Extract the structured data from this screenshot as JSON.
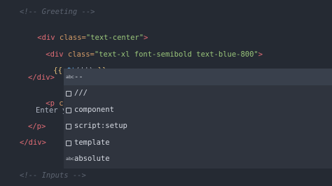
{
  "editor": {
    "lines": {
      "comment_greeting": "<!-- Greeting -->",
      "div_open_tag": "<div",
      "div_class_attr": " class=",
      "div_class_value": "\"text-center\"",
      "div_close_bracket": ">",
      "inner_div_open": "<div",
      "inner_div_attr": " class=",
      "inner_div_value": "\"text-xl font-semibold text-blue-800\"",
      "inner_div_close": ">",
      "mustache_open": "{{ ",
      "fn_call": "$t",
      "fn_args": "('')",
      "mustache_close": " }}",
      "inner_div_end": "</div>",
      "p_open": "<p",
      "p_attr_partial": " class=",
      "enter_text": "Enter y",
      "p_end": "</p>",
      "div_end": "</div>",
      "comment_inputs": "<!-- Inputs -->"
    }
  },
  "suggestions": {
    "items": [
      {
        "kind": "abc",
        "kind_icon": "text-abc-icon",
        "label": "--"
      },
      {
        "kind": "snippet",
        "kind_icon": "snippet-icon",
        "label": "///"
      },
      {
        "kind": "snippet",
        "kind_icon": "snippet-icon",
        "label": "component"
      },
      {
        "kind": "snippet",
        "kind_icon": "snippet-icon",
        "label": "script:setup"
      },
      {
        "kind": "snippet",
        "kind_icon": "snippet-icon",
        "label": "template"
      },
      {
        "kind": "abc",
        "kind_icon": "text-abc-icon",
        "label": "absolute"
      }
    ],
    "abc_text": "abc"
  },
  "colors": {
    "background": "#252a33",
    "tag": "#e06c75",
    "attribute": "#d19a66",
    "string": "#98c379",
    "comment": "#5c6370",
    "suggest_background": "#2f343e"
  }
}
